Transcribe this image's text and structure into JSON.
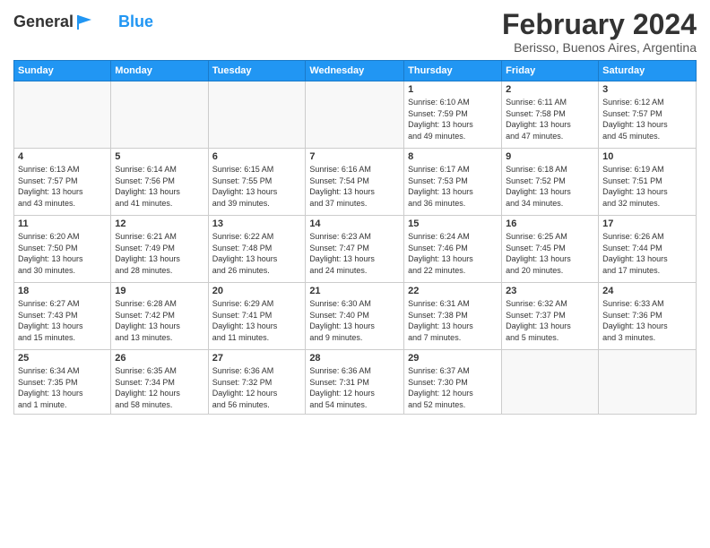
{
  "logo": {
    "line1": "General",
    "line2": "Blue"
  },
  "title": "February 2024",
  "subtitle": "Berisso, Buenos Aires, Argentina",
  "headers": [
    "Sunday",
    "Monday",
    "Tuesday",
    "Wednesday",
    "Thursday",
    "Friday",
    "Saturday"
  ],
  "weeks": [
    [
      {
        "day": "",
        "info": ""
      },
      {
        "day": "",
        "info": ""
      },
      {
        "day": "",
        "info": ""
      },
      {
        "day": "",
        "info": ""
      },
      {
        "day": "1",
        "info": "Sunrise: 6:10 AM\nSunset: 7:59 PM\nDaylight: 13 hours\nand 49 minutes."
      },
      {
        "day": "2",
        "info": "Sunrise: 6:11 AM\nSunset: 7:58 PM\nDaylight: 13 hours\nand 47 minutes."
      },
      {
        "day": "3",
        "info": "Sunrise: 6:12 AM\nSunset: 7:57 PM\nDaylight: 13 hours\nand 45 minutes."
      }
    ],
    [
      {
        "day": "4",
        "info": "Sunrise: 6:13 AM\nSunset: 7:57 PM\nDaylight: 13 hours\nand 43 minutes."
      },
      {
        "day": "5",
        "info": "Sunrise: 6:14 AM\nSunset: 7:56 PM\nDaylight: 13 hours\nand 41 minutes."
      },
      {
        "day": "6",
        "info": "Sunrise: 6:15 AM\nSunset: 7:55 PM\nDaylight: 13 hours\nand 39 minutes."
      },
      {
        "day": "7",
        "info": "Sunrise: 6:16 AM\nSunset: 7:54 PM\nDaylight: 13 hours\nand 37 minutes."
      },
      {
        "day": "8",
        "info": "Sunrise: 6:17 AM\nSunset: 7:53 PM\nDaylight: 13 hours\nand 36 minutes."
      },
      {
        "day": "9",
        "info": "Sunrise: 6:18 AM\nSunset: 7:52 PM\nDaylight: 13 hours\nand 34 minutes."
      },
      {
        "day": "10",
        "info": "Sunrise: 6:19 AM\nSunset: 7:51 PM\nDaylight: 13 hours\nand 32 minutes."
      }
    ],
    [
      {
        "day": "11",
        "info": "Sunrise: 6:20 AM\nSunset: 7:50 PM\nDaylight: 13 hours\nand 30 minutes."
      },
      {
        "day": "12",
        "info": "Sunrise: 6:21 AM\nSunset: 7:49 PM\nDaylight: 13 hours\nand 28 minutes."
      },
      {
        "day": "13",
        "info": "Sunrise: 6:22 AM\nSunset: 7:48 PM\nDaylight: 13 hours\nand 26 minutes."
      },
      {
        "day": "14",
        "info": "Sunrise: 6:23 AM\nSunset: 7:47 PM\nDaylight: 13 hours\nand 24 minutes."
      },
      {
        "day": "15",
        "info": "Sunrise: 6:24 AM\nSunset: 7:46 PM\nDaylight: 13 hours\nand 22 minutes."
      },
      {
        "day": "16",
        "info": "Sunrise: 6:25 AM\nSunset: 7:45 PM\nDaylight: 13 hours\nand 20 minutes."
      },
      {
        "day": "17",
        "info": "Sunrise: 6:26 AM\nSunset: 7:44 PM\nDaylight: 13 hours\nand 17 minutes."
      }
    ],
    [
      {
        "day": "18",
        "info": "Sunrise: 6:27 AM\nSunset: 7:43 PM\nDaylight: 13 hours\nand 15 minutes."
      },
      {
        "day": "19",
        "info": "Sunrise: 6:28 AM\nSunset: 7:42 PM\nDaylight: 13 hours\nand 13 minutes."
      },
      {
        "day": "20",
        "info": "Sunrise: 6:29 AM\nSunset: 7:41 PM\nDaylight: 13 hours\nand 11 minutes."
      },
      {
        "day": "21",
        "info": "Sunrise: 6:30 AM\nSunset: 7:40 PM\nDaylight: 13 hours\nand 9 minutes."
      },
      {
        "day": "22",
        "info": "Sunrise: 6:31 AM\nSunset: 7:38 PM\nDaylight: 13 hours\nand 7 minutes."
      },
      {
        "day": "23",
        "info": "Sunrise: 6:32 AM\nSunset: 7:37 PM\nDaylight: 13 hours\nand 5 minutes."
      },
      {
        "day": "24",
        "info": "Sunrise: 6:33 AM\nSunset: 7:36 PM\nDaylight: 13 hours\nand 3 minutes."
      }
    ],
    [
      {
        "day": "25",
        "info": "Sunrise: 6:34 AM\nSunset: 7:35 PM\nDaylight: 13 hours\nand 1 minute."
      },
      {
        "day": "26",
        "info": "Sunrise: 6:35 AM\nSunset: 7:34 PM\nDaylight: 12 hours\nand 58 minutes."
      },
      {
        "day": "27",
        "info": "Sunrise: 6:36 AM\nSunset: 7:32 PM\nDaylight: 12 hours\nand 56 minutes."
      },
      {
        "day": "28",
        "info": "Sunrise: 6:36 AM\nSunset: 7:31 PM\nDaylight: 12 hours\nand 54 minutes."
      },
      {
        "day": "29",
        "info": "Sunrise: 6:37 AM\nSunset: 7:30 PM\nDaylight: 12 hours\nand 52 minutes."
      },
      {
        "day": "",
        "info": ""
      },
      {
        "day": "",
        "info": ""
      }
    ]
  ]
}
